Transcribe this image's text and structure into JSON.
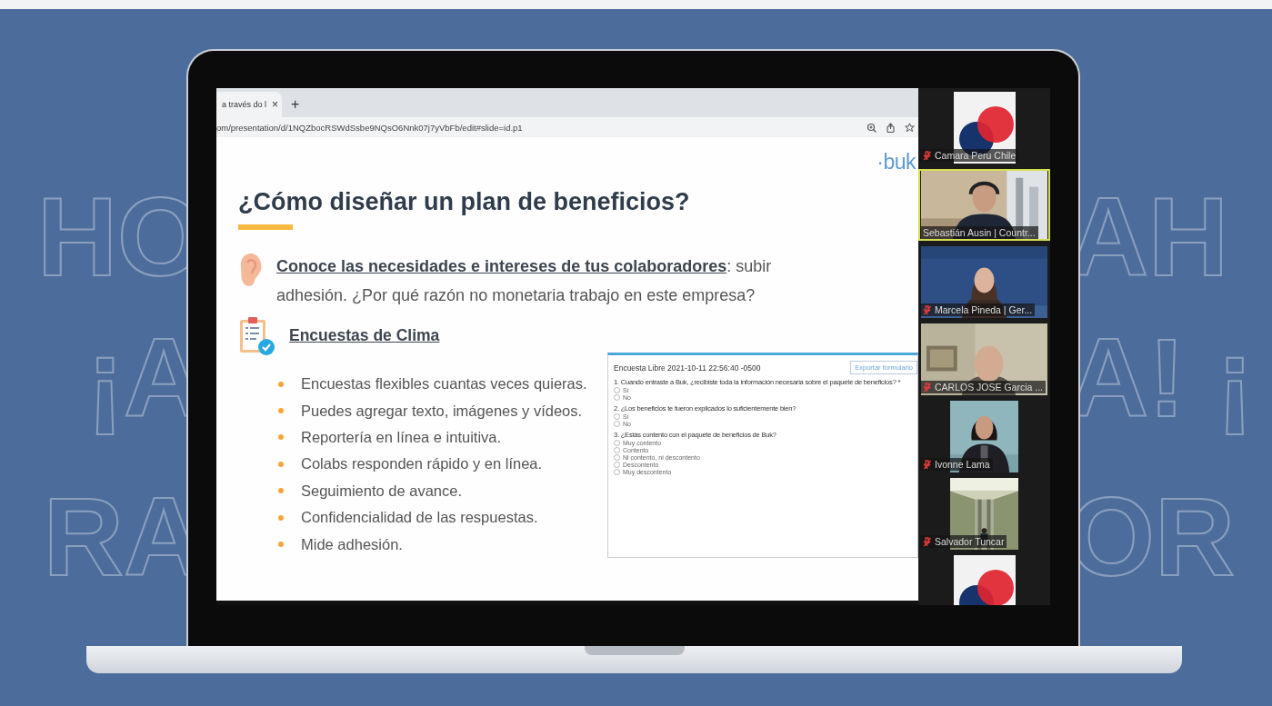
{
  "backdrop": {
    "left": [
      "HO",
      "¡A",
      "RA"
    ],
    "right": [
      "AH",
      "A! ¡",
      "OR"
    ]
  },
  "browser": {
    "tab": {
      "title": "a través do l",
      "close": "×"
    },
    "new_tab": "+",
    "address": "om/presentation/d/1NQZbocRSWdSsbe9NQsO6Nnk07j7yVbFb/edit#slide=id.p1"
  },
  "slide": {
    "logo": "·buk",
    "title": "¿Cómo diseñar un plan de beneficios?",
    "point": "**Conoce las necesidades e intereses de tus colaboradores**: subir adhesión. ¿Por qué razón no monetaria trabajo en este empresa?",
    "heading": "Encuestas de Clima",
    "bullets": [
      "Encuestas flexibles cuantas veces quieras.",
      "Puedes agregar texto, imágenes y vídeos.",
      "Reportería en línea e intuitiva.",
      "Colabs responden rápido y en línea.",
      "Seguimiento de avance.",
      "Confidencialidad de las respuestas.",
      "Mide adhesión."
    ],
    "survey": {
      "title": "Encuesta Libre 2021-10-11 22:56:40 -0500",
      "button": "Exportar formulario",
      "questions": [
        {
          "text": "1. Cuando entraste a Buk, ¿recibiste toda la información necesaria sobre el paquete de beneficios? *",
          "options": [
            {
              "label": "Sí",
              "selected": false
            },
            {
              "label": "No",
              "selected": false
            }
          ]
        },
        {
          "text": "2. ¿Los beneficios te fueron explicados lo suficientemente bien?",
          "options": [
            {
              "label": "Sí",
              "selected": false
            },
            {
              "label": "No",
              "selected": false
            }
          ]
        },
        {
          "text": "3. ¿Estás contento con el paquete de beneficios de Buk?",
          "options": [
            {
              "label": "Muy contento",
              "selected": false
            },
            {
              "label": "Contento",
              "selected": false
            },
            {
              "label": "Ni contento, ni descontento",
              "selected": false
            },
            {
              "label": "Descontento",
              "selected": false
            },
            {
              "label": "Muy descontento",
              "selected": false
            }
          ]
        }
      ]
    }
  },
  "participants": [
    {
      "kind": "logo",
      "name": "Camara Peru Chile",
      "muted": true,
      "selected": false
    },
    {
      "kind": "video",
      "name": "Sebastián Ausin | Countr...",
      "muted": false,
      "selected": true
    },
    {
      "kind": "video",
      "name": "Marcela Pineda | Ger...",
      "muted": true,
      "selected": false
    },
    {
      "kind": "video",
      "name": "CARLOS JOSE Garcia ...",
      "muted": true,
      "selected": false
    },
    {
      "name": "Ivonne Lama",
      "muted": true,
      "selected": false
    },
    {
      "name": "Salvador Tuncar",
      "muted": true,
      "selected": false
    },
    {
      "kind": "logo",
      "selected": false
    }
  ]
}
